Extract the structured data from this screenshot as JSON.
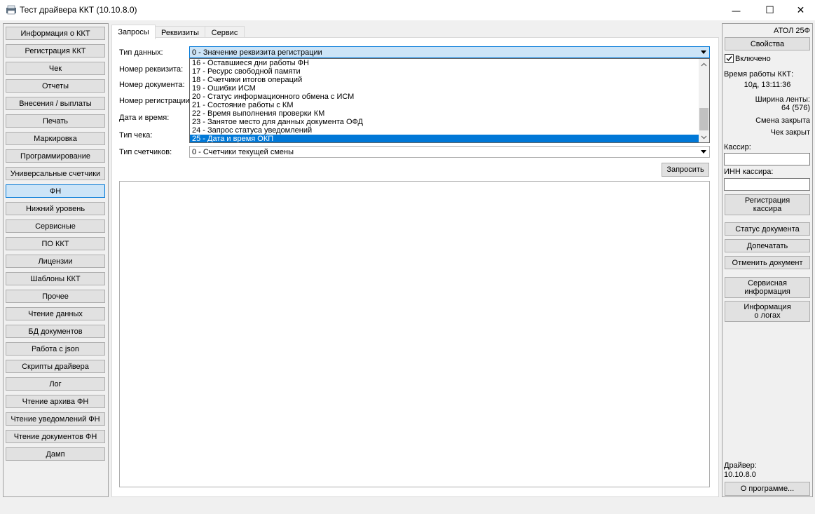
{
  "window": {
    "title": "Тест драйвера ККТ (10.10.8.0)",
    "minimize_glyph": "—",
    "maximize_glyph": "☐",
    "close_glyph": "✕"
  },
  "sidebar": {
    "items": [
      {
        "label": "Информация о ККТ"
      },
      {
        "label": "Регистрация ККТ"
      },
      {
        "label": "Чек"
      },
      {
        "label": "Отчеты"
      },
      {
        "label": "Внесения / выплаты"
      },
      {
        "label": "Печать"
      },
      {
        "label": "Маркировка"
      },
      {
        "label": "Программирование"
      },
      {
        "label": "Универсальные счетчики"
      },
      {
        "label": "ФН"
      },
      {
        "label": "Нижний уровень"
      },
      {
        "label": "Сервисные"
      },
      {
        "label": "ПО ККТ"
      },
      {
        "label": "Лицензии"
      },
      {
        "label": "Шаблоны ККТ"
      },
      {
        "label": "Прочее"
      },
      {
        "label": "Чтение данных"
      },
      {
        "label": "БД документов"
      },
      {
        "label": "Работа с json"
      },
      {
        "label": "Скрипты драйвера"
      },
      {
        "label": "Лог"
      },
      {
        "label": "Чтение архива ФН"
      },
      {
        "label": "Чтение уведомлений ФН"
      },
      {
        "label": "Чтение документов ФН"
      },
      {
        "label": "Дамп"
      }
    ],
    "active": "ФН"
  },
  "tabs": [
    {
      "label": "Запросы"
    },
    {
      "label": "Реквизиты"
    },
    {
      "label": "Сервис"
    }
  ],
  "form": {
    "data_type_label": "Тип данных:",
    "data_type_value": "0 - Значение реквизита регистрации",
    "requisite_number_label": "Номер реквизита:",
    "document_number_label": "Номер документа:",
    "registration_number_label": "Номер регистрации:",
    "datetime_label": "Дата и время:",
    "receipt_type_label": "Тип чека:",
    "counters_type_label": "Тип счетчиков:",
    "counters_type_value": "0 - Счетчики текущей смены",
    "request_button": "Запросить"
  },
  "dropdown": {
    "items": [
      "16 - Оставшиеся дни работы ФН",
      "17 - Ресурс свободной памяти",
      "18 - Счетчики итогов операций",
      "19 - Ошибки ИСМ",
      "20 - Статус информационного обмена с ИСМ",
      "21 - Состояние работы с КМ",
      "22 - Время выполнения проверки КМ",
      "23 - Занятое место для данных документа ОФД",
      "24 - Запрос статуса уведомлений",
      "25 - Дата и время ОКП"
    ],
    "selected_index": 9
  },
  "right_panel": {
    "device_name": "АТОЛ 25Ф",
    "properties_button": "Свойства",
    "enabled_label": "Включено",
    "enabled_checked": true,
    "uptime_label": "Время работы ККТ:",
    "uptime_value": "10д, 13:11:36",
    "tape_width_label": "Ширина ленты:",
    "tape_width_value": "64 (576)",
    "shift_status": "Смена закрыта",
    "receipt_status": "Чек закрыт",
    "cashier_label": "Кассир:",
    "cashier_inn_label": "ИНН кассира:",
    "register_cashier_line1": "Регистрация",
    "register_cashier_line2": "кассира",
    "doc_status_button": "Статус документа",
    "reprint_button": "Допечатать",
    "cancel_doc_button": "Отменить документ",
    "service_info_line1": "Сервисная",
    "service_info_line2": "информация",
    "logs_info_line1": "Информация",
    "logs_info_line2": "о логах",
    "driver_label": "Драйвер:",
    "driver_version": "10.10.8.0",
    "about_button": "О программе..."
  }
}
